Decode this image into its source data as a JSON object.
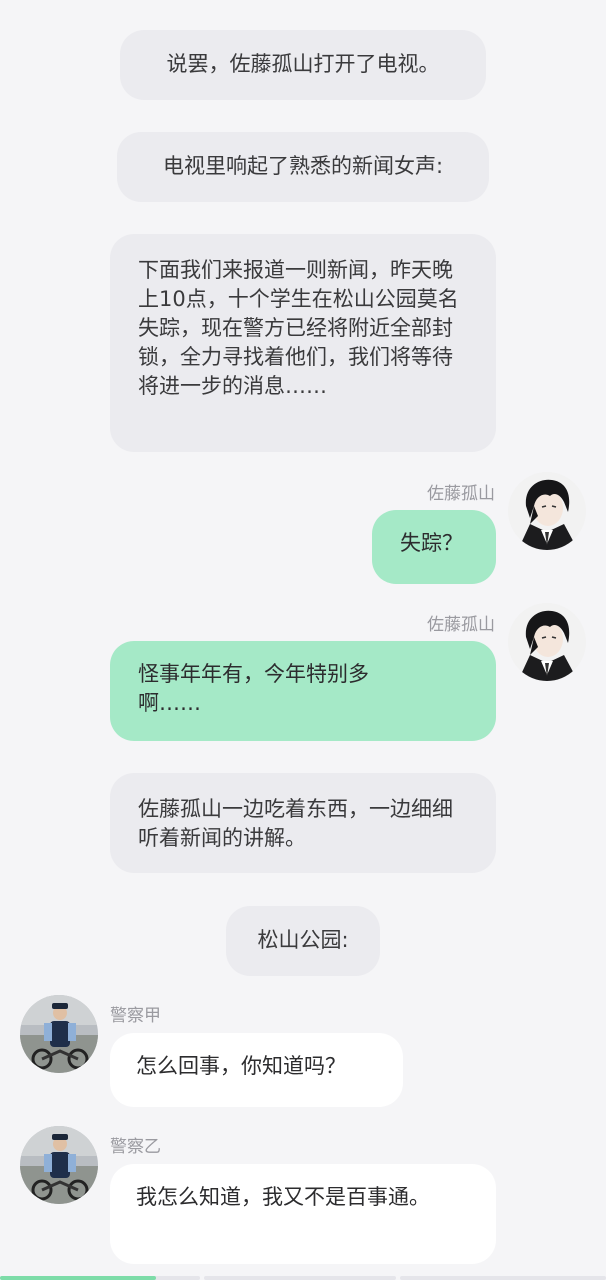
{
  "messages": {
    "n1": "说罢，佐藤孤山打开了电视。",
    "n2": "电视里响起了熟悉的新闻女声:",
    "n3": "下面我们来报道一则新闻，昨天晚上10点，十个学生在松山公园莫名失踪，现在警方已经将附近全部封锁，全力寻找着他们，我们将等待将进一步的消息……",
    "m1_name": "佐藤孤山",
    "m1_text": "失踪？",
    "m2_name": "佐藤孤山",
    "m2_text": "怪事年年有，今年特别多啊……",
    "n4": "佐藤孤山一边吃着东西，一边细细听着新闻的讲解。",
    "n5": "松山公园:",
    "o1_name": "警察甲",
    "o1_text": "怎么回事，你知道吗？",
    "o2_name": "警察乙",
    "o2_text": "我怎么知道，我又不是百事通。"
  },
  "avatars": {
    "me": "anime-character-avatar",
    "police": "police-officer-photo-avatar"
  },
  "progress": {
    "segments": 4,
    "current_segment_fraction": 0.6
  },
  "colors": {
    "background": "#f5f5f7",
    "narration_bubble": "#ebebef",
    "self_bubble": "#a5e9c7",
    "other_bubble": "#ffffff",
    "progress": "#7ddca8"
  }
}
